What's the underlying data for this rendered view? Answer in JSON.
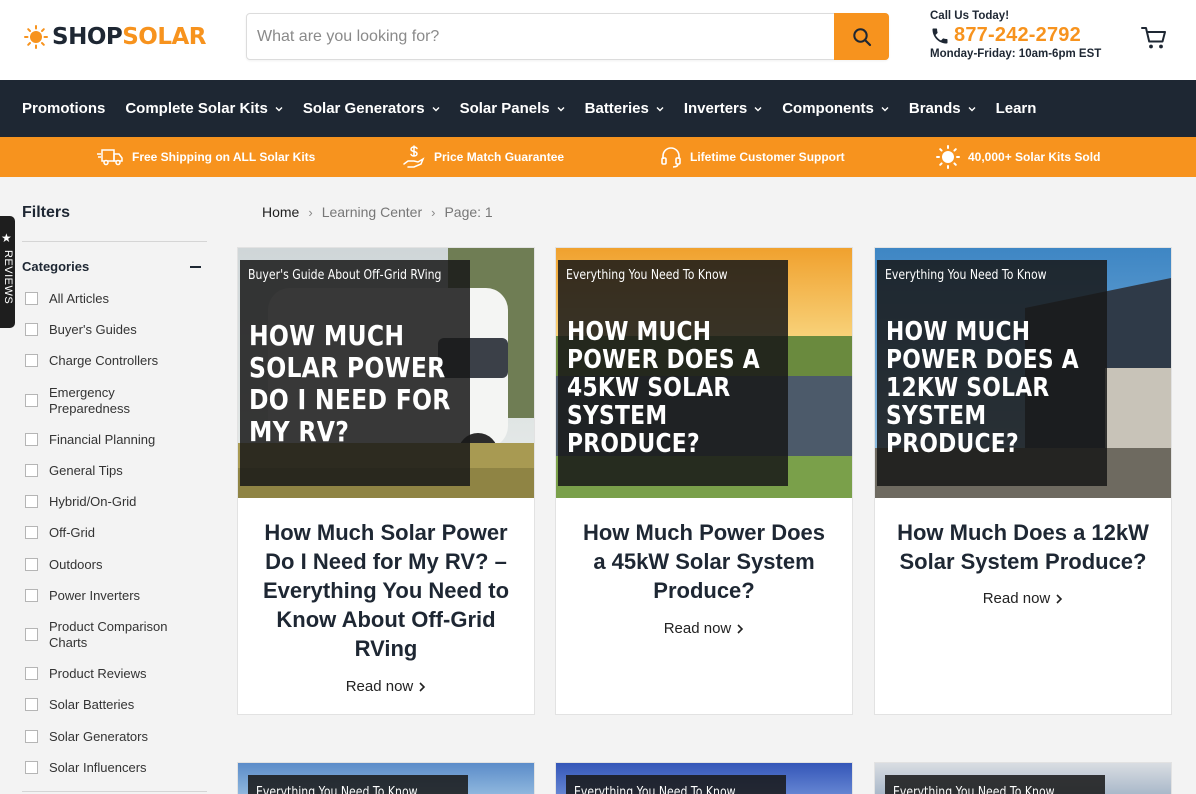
{
  "header": {
    "logo_shop": "SHOP",
    "logo_solar": "SOLAR",
    "search_placeholder": "What are you looking for?",
    "call_label": "Call Us Today!",
    "phone": "877-242-2792",
    "hours": "Monday-Friday: 10am-6pm EST"
  },
  "nav": [
    {
      "label": "Promotions"
    },
    {
      "label": "Complete Solar Kits"
    },
    {
      "label": "Solar Generators"
    },
    {
      "label": "Solar Panels"
    },
    {
      "label": "Batteries"
    },
    {
      "label": "Inverters"
    },
    {
      "label": "Components"
    },
    {
      "label": "Brands"
    },
    {
      "label": "Learn"
    }
  ],
  "perks": [
    {
      "label": "Free Shipping on ALL Solar Kits",
      "icon": "truck-icon"
    },
    {
      "label": "Price Match Guarantee",
      "icon": "hand-dollar-icon"
    },
    {
      "label": "Lifetime Customer Support",
      "icon": "headset-icon"
    },
    {
      "label": "40,000+ Solar Kits Sold",
      "icon": "sun-icon"
    }
  ],
  "reviews_tab": "REVIEWS",
  "sidebar": {
    "title": "Filters",
    "categories_label": "Categories",
    "categories": [
      "All Articles",
      "Buyer's Guides",
      "Charge Controllers",
      "Emergency Preparedness",
      "Financial Planning",
      "General Tips",
      "Hybrid/On-Grid",
      "Off-Grid",
      "Outdoors",
      "Power Inverters",
      "Product Comparison Charts",
      "Product Reviews",
      "Solar Batteries",
      "Solar Generators",
      "Solar Influencers"
    ]
  },
  "breadcrumb": {
    "home": "Home",
    "section": "Learning Center",
    "page": "Page: 1"
  },
  "articles": [
    {
      "kicker": "Buyer's Guide About Off-Grid RVing",
      "image_title": "HOW MUCH SOLAR POWER DO I NEED FOR MY RV?",
      "title": "How Much Solar Power Do I Need for My RV? – Everything You Need to Know About Off-Grid RVing",
      "read_more": "Read now"
    },
    {
      "kicker": "Everything You Need To Know",
      "image_title": "HOW MUCH POWER DOES A 45KW SOLAR SYSTEM PRODUCE?",
      "title": "How Much Power Does a 45kW Solar System Produce?",
      "read_more": "Read now"
    },
    {
      "kicker": "Everything You Need To Know",
      "image_title": "HOW MUCH POWER DOES A 12KW SOLAR SYSTEM PRODUCE?",
      "title": "How Much Does a 12kW Solar System Produce?",
      "read_more": "Read now"
    }
  ],
  "next_row_kickers": [
    "Everything You Need To Know",
    "Everything You Need To Know",
    "Everything You Need To Know"
  ],
  "colors": {
    "brand_orange": "#f7931e",
    "nav_dark": "#1e2733"
  }
}
